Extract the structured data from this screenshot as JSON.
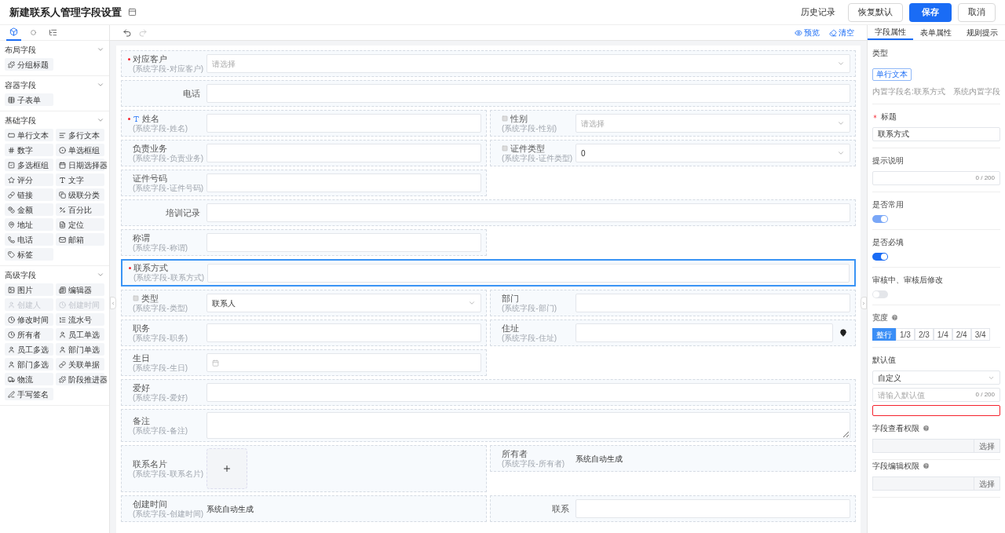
{
  "header": {
    "title": "新建联系人管理字段设置",
    "actions": [
      {
        "label": "历史记录",
        "kind": "text"
      },
      {
        "label": "恢复默认",
        "kind": "default"
      },
      {
        "label": "保存",
        "kind": "primary"
      },
      {
        "label": "取消",
        "kind": "default"
      }
    ]
  },
  "palette": {
    "tabs": [
      {
        "kind": "cube",
        "selected": true
      },
      {
        "kind": "dot",
        "selected": false
      },
      {
        "kind": "tree",
        "selected": false
      }
    ],
    "sections": [
      {
        "title": "布局字段",
        "expanded": true,
        "items": [
          {
            "label": "分组标题",
            "kind": "puzzle",
            "disabled": false
          }
        ]
      },
      {
        "title": "容器字段",
        "expanded": true,
        "items": [
          {
            "label": "子表单",
            "kind": "table",
            "disabled": false
          }
        ]
      },
      {
        "title": "基础字段",
        "expanded": true,
        "items": [
          {
            "label": "单行文本",
            "kind": "textbox",
            "disabled": false
          },
          {
            "label": "多行文本",
            "kind": "textarea",
            "disabled": false
          },
          {
            "label": "数字",
            "kind": "number",
            "disabled": false
          },
          {
            "label": "单选框组",
            "kind": "radio",
            "disabled": false
          },
          {
            "label": "多选框组",
            "kind": "checkbox",
            "disabled": false
          },
          {
            "label": "日期选择器",
            "kind": "calendar",
            "disabled": false
          },
          {
            "label": "评分",
            "kind": "star",
            "disabled": false
          },
          {
            "label": "文字",
            "kind": "type",
            "disabled": false
          },
          {
            "label": "链接",
            "kind": "link",
            "disabled": false
          },
          {
            "label": "级联分类",
            "kind": "copy",
            "disabled": false
          },
          {
            "label": "金额",
            "kind": "coins",
            "disabled": false
          },
          {
            "label": "百分比",
            "kind": "percent",
            "disabled": false
          },
          {
            "label": "地址",
            "kind": "pin",
            "disabled": false
          },
          {
            "label": "定位",
            "kind": "file",
            "disabled": false
          },
          {
            "label": "电话",
            "kind": "phone",
            "disabled": false
          },
          {
            "label": "邮箱",
            "kind": "mail",
            "disabled": false
          },
          {
            "label": "标签",
            "kind": "tag",
            "disabled": false
          }
        ]
      },
      {
        "title": "高级字段",
        "expanded": true,
        "items": [
          {
            "label": "图片",
            "kind": "image",
            "disabled": false
          },
          {
            "label": "编辑器",
            "kind": "editor",
            "disabled": false
          },
          {
            "label": "创建人",
            "kind": "user",
            "disabled": true
          },
          {
            "label": "创建时间",
            "kind": "clock",
            "disabled": true
          },
          {
            "label": "修改时间",
            "kind": "clock",
            "disabled": false
          },
          {
            "label": "流水号",
            "kind": "list",
            "disabled": false
          },
          {
            "label": "所有者",
            "kind": "clock",
            "disabled": false
          },
          {
            "label": "员工单选",
            "kind": "user",
            "disabled": false
          },
          {
            "label": "员工多选",
            "kind": "user",
            "disabled": false
          },
          {
            "label": "部门单选",
            "kind": "user",
            "disabled": false
          },
          {
            "label": "部门多选",
            "kind": "user",
            "disabled": false
          },
          {
            "label": "关联单据",
            "kind": "link",
            "disabled": false
          },
          {
            "label": "物流",
            "kind": "truck",
            "disabled": false
          },
          {
            "label": "阶段推进器",
            "kind": "puzzle",
            "disabled": false
          },
          {
            "label": "手写签名",
            "kind": "pen",
            "disabled": false
          }
        ]
      }
    ]
  },
  "toolbar": {
    "history": [
      {
        "kind": "undo",
        "disabled": false
      },
      {
        "kind": "redo",
        "disabled": true
      }
    ],
    "actions": [
      {
        "label": "预览",
        "kind": "eye"
      },
      {
        "label": "清空",
        "kind": "eraser"
      }
    ]
  },
  "form": {
    "fields": [
      {
        "label": "对应客户",
        "sub": "(系统字段-对应客户)",
        "kind": "select",
        "full_row": true,
        "required": true,
        "placeholder": "请选择",
        "selected": false
      },
      {
        "label": "电话",
        "kind": "input",
        "full_row": true,
        "required": false,
        "selected": false
      },
      {
        "label": "姓名",
        "sub": "(系统字段-姓名)",
        "kind": "input",
        "full_row": false,
        "required": true,
        "letter_icon": true,
        "selected": false
      },
      {
        "label": "性别",
        "sub": "(系统字段-性别)",
        "kind": "select",
        "full_row": false,
        "required": false,
        "square_icon": true,
        "placeholder": "请选择",
        "selected": false
      },
      {
        "label": "负责业务",
        "sub": "(系统字段-负责业务)",
        "kind": "input",
        "full_row": false,
        "required": false,
        "selected": false
      },
      {
        "label": "证件类型",
        "sub": "(系统字段-证件类型)",
        "kind": "select",
        "full_row": false,
        "required": false,
        "square_icon": true,
        "value": "0",
        "selected": false
      },
      {
        "label": "证件号码",
        "sub": "(系统字段-证件号码)",
        "kind": "input",
        "full_row": false,
        "required": false,
        "selected": false
      },
      {
        "label": "培训记录",
        "kind": "input",
        "full_row": true,
        "required": false,
        "selected": false
      },
      {
        "label": "称谓",
        "sub": "(系统字段-称谓)",
        "kind": "input",
        "full_row": false,
        "required": false,
        "selected": false
      },
      {
        "label": "联系方式",
        "sub": "(系统字段-联系方式)",
        "kind": "input",
        "full_row": true,
        "required": true,
        "selected": true
      },
      {
        "label": "类型",
        "sub": "(系统字段-类型)",
        "kind": "select",
        "full_row": false,
        "required": false,
        "square_icon": true,
        "value": "联系人",
        "selected": false
      },
      {
        "label": "部门",
        "sub": "(系统字段-部门)",
        "kind": "input",
        "full_row": false,
        "required": false,
        "selected": false
      },
      {
        "label": "职务",
        "sub": "(系统字段-职务)",
        "kind": "input",
        "full_row": false,
        "required": false,
        "selected": false
      },
      {
        "label": "住址",
        "sub": "(系统字段-住址)",
        "kind": "address",
        "full_row": false,
        "required": false,
        "selected": false
      },
      {
        "label": "生日",
        "sub": "(系统字段-生日)",
        "kind": "date",
        "full_row": false,
        "required": false,
        "selected": false
      },
      {
        "label": "爱好",
        "sub": "(系统字段-爱好)",
        "kind": "input",
        "full_row": true,
        "required": false,
        "selected": false
      },
      {
        "label": "备注",
        "sub": "(系统字段-备注)",
        "kind": "textarea",
        "full_row": true,
        "required": false,
        "selected": false
      },
      {
        "label": "联系名片",
        "sub": "(系统字段-联系名片)",
        "kind": "upload",
        "full_row": false,
        "required": false,
        "selected": false
      },
      {
        "label": "所有者",
        "sub": "(系统字段-所有者)",
        "kind": "auto",
        "full_row": false,
        "required": false,
        "value": "系统自动生成",
        "selected": false
      },
      {
        "label": "创建时间",
        "sub": "(系统字段-创建时间)",
        "kind": "auto",
        "full_row": false,
        "required": false,
        "value": "系统自动生成",
        "selected": false
      },
      {
        "label": "联系",
        "kind": "input",
        "full_row": false,
        "required": false,
        "selected": false
      }
    ]
  },
  "properties": {
    "tabs": [
      {
        "label": "字段属性",
        "selected": true
      },
      {
        "label": "表单属性",
        "selected": false
      },
      {
        "label": "规则提示",
        "selected": false
      }
    ],
    "type": {
      "label": "类型",
      "tag": "单行文本",
      "builtin_name": "内置字段名:联系方式",
      "builtin_note": "系统内置字段"
    },
    "title": {
      "label": "标题",
      "required": true,
      "value": "联系方式"
    },
    "hint": {
      "label": "提示说明",
      "counter": "0 / 200"
    },
    "toggles": [
      {
        "label": "是否常用",
        "on": true,
        "disabled": true
      },
      {
        "label": "是否必填",
        "on": true,
        "disabled": false
      },
      {
        "label": "审核中、审核后修改",
        "on": false,
        "disabled": true
      }
    ],
    "width": {
      "label": "宽度",
      "options": [
        {
          "label": "整行",
          "selected": true
        },
        {
          "label": "1/3",
          "selected": false
        },
        {
          "label": "2/3",
          "selected": false
        },
        {
          "label": "1/4",
          "selected": false
        },
        {
          "label": "2/4",
          "selected": false
        },
        {
          "label": "3/4",
          "selected": false
        }
      ]
    },
    "default_value": {
      "label": "默认值",
      "mode": "自定义",
      "placeholder": "请输入默认值",
      "counter": "0 / 200",
      "error": true
    },
    "permissions": [
      {
        "label": "字段查看权限",
        "button": "选择"
      },
      {
        "label": "字段编辑权限",
        "button": "选择"
      }
    ]
  }
}
